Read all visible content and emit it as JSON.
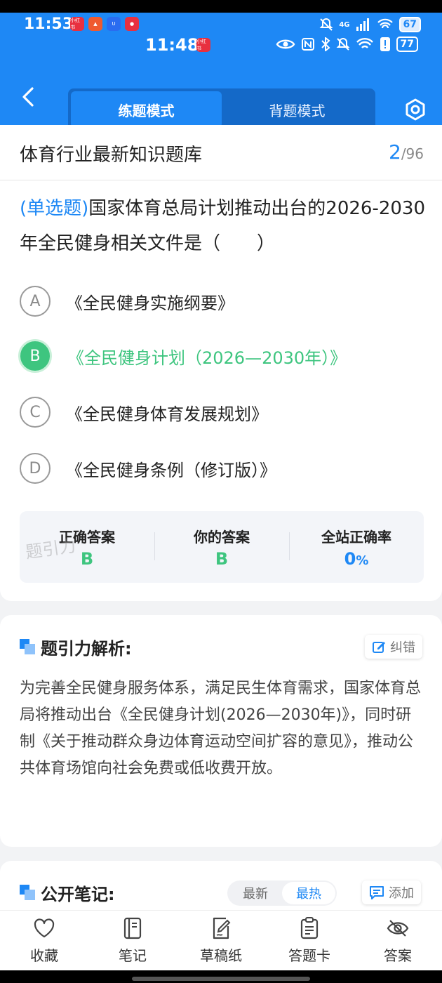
{
  "status_bar": {
    "time_primary": "11:53",
    "time_secondary": "11:48",
    "app_icon_label": "小红书",
    "battery_primary": "67",
    "battery_secondary": "77",
    "signal_label": "4G"
  },
  "header": {
    "modes": [
      {
        "label": "练题模式",
        "active": true
      },
      {
        "label": "背题模式",
        "active": false
      }
    ]
  },
  "question": {
    "bank_title": "体育行业最新知识题库",
    "current_index": "2",
    "total": "/96",
    "type": "(单选题)",
    "stem": "国家体育总局计划推动出台的2026-2030年全民健身相关文件是（　　）",
    "options": [
      {
        "letter": "A",
        "text": "《全民健身实施纲要》",
        "correct": false
      },
      {
        "letter": "B",
        "text": "《全民健身计划（2026—2030年）》",
        "correct": true
      },
      {
        "letter": "C",
        "text": "《全民健身体育发展规划》",
        "correct": false
      },
      {
        "letter": "D",
        "text": "《全民健身条例（修订版）》",
        "correct": false
      }
    ],
    "stats": {
      "correct_answer_label": "正确答案",
      "correct_answer": "B",
      "your_answer_label": "你的答案",
      "your_answer": "B",
      "site_rate_label": "全站正确率",
      "site_rate": "0",
      "site_rate_unit": "%"
    },
    "watermark": "题引力"
  },
  "analysis": {
    "title": "题引力解析:",
    "error_button": "纠错",
    "text": "为完善全民健身服务体系，满足民生体育需求，国家体育总局将推动出台《全民健身计划(2026—2030年)》，同时研制《关于推动群众身边体育运动空间扩容的意见》，推动公共体育场馆向社会免费或低收费开放。"
  },
  "notes": {
    "title": "公开笔记:",
    "sort_options": [
      {
        "label": "最新",
        "active": false
      },
      {
        "label": "最热",
        "active": true
      }
    ],
    "add_button": "添加"
  },
  "bottom_nav": [
    {
      "label": "收藏",
      "icon": "heart-icon"
    },
    {
      "label": "笔记",
      "icon": "notebook-icon"
    },
    {
      "label": "草稿纸",
      "icon": "draft-icon"
    },
    {
      "label": "答题卡",
      "icon": "clipboard-icon"
    },
    {
      "label": "答案",
      "icon": "eye-off-icon"
    }
  ],
  "colors": {
    "primary": "#1e88f5",
    "correct": "#3ec57f"
  }
}
